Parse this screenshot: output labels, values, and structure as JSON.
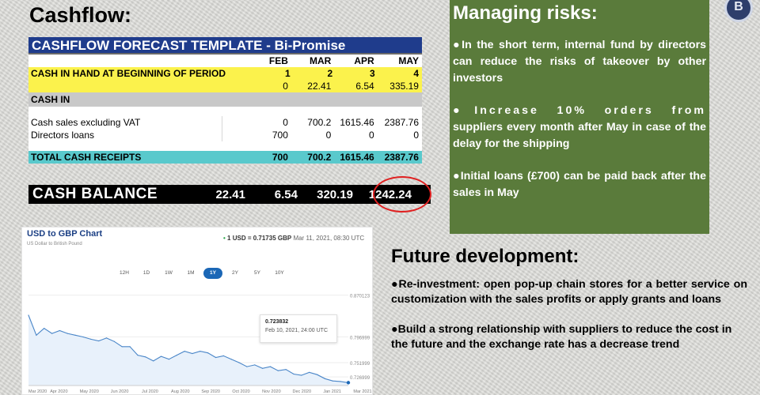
{
  "cashflow_heading": "Cashflow:",
  "sheet": {
    "title": "CASHFLOW FORECAST TEMPLATE - Bi-Promise",
    "months": [
      "FEB",
      "MAR",
      "APR",
      "MAY"
    ],
    "cash_in_hand_label": "CASH IN HAND AT BEGINNING OF PERIOD",
    "period_numbers": [
      "1",
      "2",
      "3",
      "4"
    ],
    "opening_values": [
      "0",
      "22.41",
      "6.54",
      "335.19"
    ],
    "cash_in_label": "CASH IN",
    "rows": [
      {
        "label": "Cash sales excluding VAT",
        "values": [
          "0",
          "700.2",
          "1615.46",
          "2387.76"
        ]
      },
      {
        "label": "Directors loans",
        "values": [
          "700",
          "0",
          "0",
          "0"
        ]
      }
    ],
    "total_label": "TOTAL CASH RECEIPTS",
    "total_values": [
      "700",
      "700.2",
      "1615.46",
      "2387.76"
    ]
  },
  "cash_balance": {
    "label": "CASH BALANCE",
    "values": [
      "22.41",
      "6.54",
      "320.19",
      "1242.24"
    ]
  },
  "fx_chart": {
    "title": "USD to GBP Chart",
    "subtitle": "US Dollar to British Pound",
    "rate_text": "1 USD = 0.71735 GBP",
    "rate_time": "Mar 11, 2021, 08:30 UTC",
    "ranges": [
      "12H",
      "1D",
      "1W",
      "1M",
      "1Y",
      "2Y",
      "5Y",
      "10Y"
    ],
    "active_range": "1Y",
    "tooltip_value": "0.723832",
    "tooltip_date": "Feb 10, 2021, 24:00 UTC",
    "colors": {
      "line": "#4a86c8",
      "fill": "#e8f1fb",
      "accent": "#1b67b6"
    },
    "chart_data": {
      "type": "area",
      "title": "USD to GBP Chart",
      "x": [
        "Mar 2020",
        "Apr 2020",
        "May 2020",
        "Jun 2020",
        "Jul 2020",
        "Aug 2020",
        "Sep 2020",
        "Oct 2020",
        "Nov 2020",
        "Dec 2020",
        "Jan 2021",
        "Mar 2021"
      ],
      "y_ticks": [
        "0.870123",
        "0.796999",
        "0.751999",
        "0.726999"
      ],
      "series": [
        {
          "values": [
            0.835,
            0.8,
            0.812,
            0.803,
            0.808,
            0.803,
            0.8,
            0.797,
            0.793,
            0.79,
            0.795,
            0.789,
            0.78,
            0.78,
            0.765,
            0.762,
            0.755,
            0.763,
            0.758,
            0.765,
            0.772,
            0.768,
            0.772,
            0.769,
            0.761,
            0.764,
            0.758,
            0.752,
            0.745,
            0.748,
            0.742,
            0.745,
            0.738,
            0.74,
            0.732,
            0.73,
            0.735,
            0.731,
            0.724,
            0.72,
            0.719,
            0.717
          ]
        }
      ]
    }
  },
  "risks": {
    "title": "Managing risks:",
    "items": [
      "●In the short term, internal fund by directors can reduce the risks of takeover by other investors",
      "●Increase 10% orders from suppliers every month after May in case of the delay for the shipping",
      "●Initial loans (£700) can be paid back after the sales in May"
    ]
  },
  "logo_text": "B",
  "future": {
    "title": "Future development:",
    "items": [
      "●Re-investment: open pop-up chain stores for a better service on customization with the sales profits or apply grants and loans",
      "●Build a strong relationship with suppliers to reduce the cost in the future and the exchange rate has a decrease trend"
    ]
  }
}
